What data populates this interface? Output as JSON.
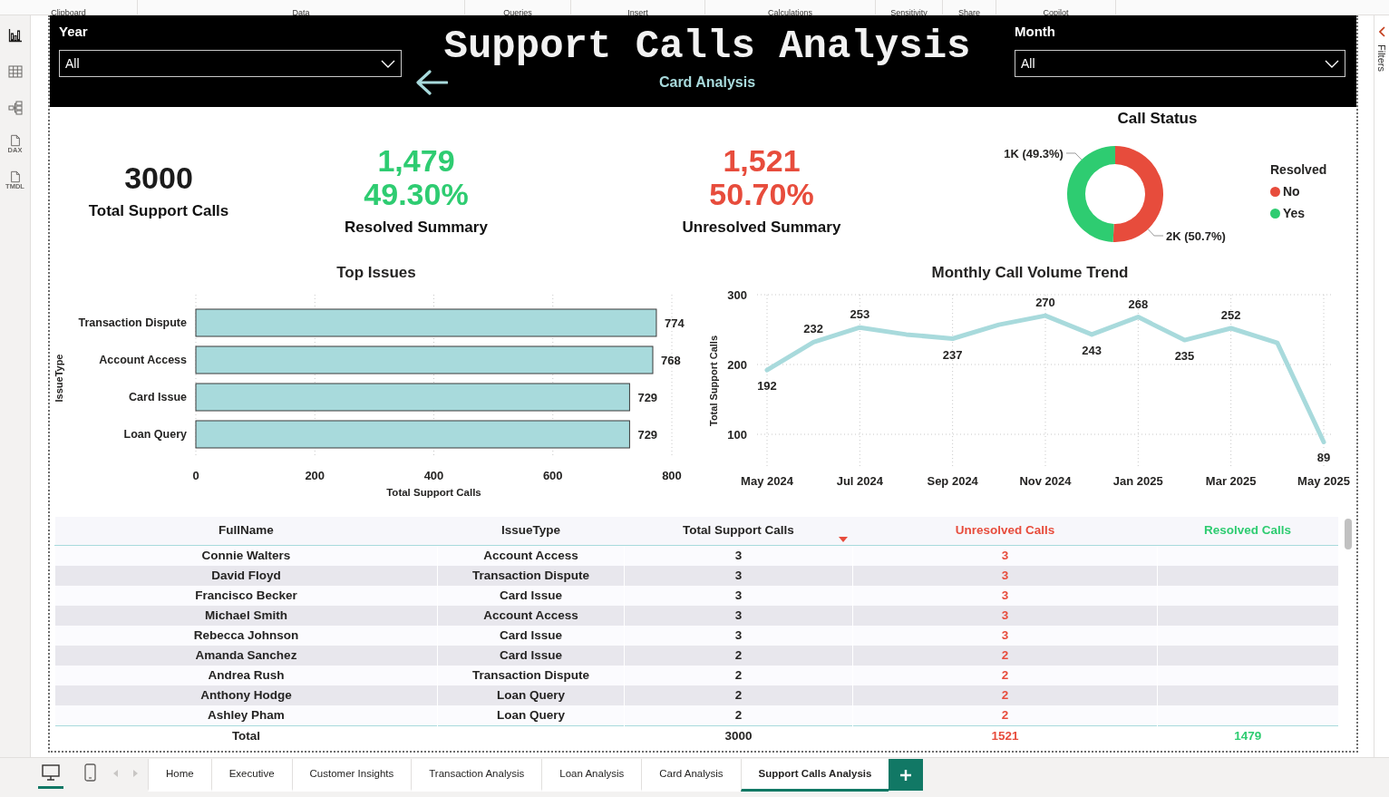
{
  "ribbon": {
    "groups": [
      "Clipboard",
      "Data",
      "Queries",
      "Insert",
      "Calculations",
      "Sensitivity",
      "Share",
      "Copilot"
    ]
  },
  "view_rail": [
    {
      "kind": "report",
      "selected": true
    },
    {
      "kind": "table",
      "selected": false
    },
    {
      "kind": "model",
      "selected": false
    },
    {
      "kind": "dax",
      "label": "DAX",
      "selected": false
    },
    {
      "kind": "tmdl",
      "label": "TMDL",
      "selected": false
    }
  ],
  "header": {
    "slicers": [
      {
        "label": "Year",
        "value": "All"
      },
      {
        "label": "Month",
        "value": "All"
      }
    ],
    "title": "Support Calls Analysis",
    "subtitle": "Card Analysis"
  },
  "kpis": [
    {
      "value": "3000",
      "label": "Total Support Calls",
      "color": "#1b1b1b"
    },
    {
      "value": "1,479",
      "percent": "49.30%",
      "label": "Resolved Summary",
      "color": "#2ecc71"
    },
    {
      "value": "1,521",
      "percent": "50.70%",
      "label": "Unresolved Summary",
      "color": "#e74c3c"
    }
  ],
  "call_status": {
    "chart_data": {
      "type": "donut",
      "title": "Call Status",
      "categories": [
        "No",
        "Yes"
      ],
      "values": [
        50.7,
        49.3
      ],
      "colors": [
        "#e74c3c",
        "#2ecc71"
      ],
      "value_labels": [
        "2K (50.7%)",
        "1K (49.3%)"
      ],
      "legend_title": "Resolved",
      "legend": "right"
    }
  },
  "top_issues": {
    "chart_data": {
      "type": "bar",
      "orientation": "horizontal",
      "title": "Top Issues",
      "xlabel": "Total Support Calls",
      "ylabel": "IssueType",
      "categories": [
        "Transaction Dispute",
        "Account Access",
        "Card Issue",
        "Loan Query"
      ],
      "values": [
        774,
        768,
        729,
        729
      ],
      "color": "#a8dadc",
      "xlim": [
        0,
        800
      ],
      "xticks": [
        0,
        200,
        400,
        600,
        800
      ],
      "data_labels": true,
      "grid": true
    }
  },
  "monthly_trend": {
    "chart_data": {
      "type": "line",
      "title": "Monthly Call Volume Trend",
      "ylabel": "Total Support Calls",
      "categories": [
        "May 2024",
        null,
        "Jul 2024",
        null,
        "Sep 2024",
        null,
        "Nov 2024",
        null,
        "Jan 2025",
        null,
        "Mar 2025",
        null,
        "May 2025"
      ],
      "values": [
        192,
        232,
        253,
        243,
        237,
        257,
        270,
        243,
        268,
        235,
        252,
        231,
        89
      ],
      "color": "#a8dadc",
      "ylim": [
        50,
        300
      ],
      "yticks": [
        100,
        200,
        300
      ],
      "value_labels": [
        "192",
        "232",
        "253",
        null,
        "237",
        null,
        "270",
        "243",
        "268",
        "235",
        "252",
        null,
        "89"
      ],
      "grid": true
    }
  },
  "table": {
    "columns": [
      {
        "label": "FullName",
        "sorted_descending": false
      },
      {
        "label": "IssueType",
        "sorted_descending": false
      },
      {
        "label": "Total Support Calls",
        "sorted_descending": true
      },
      {
        "label": "Unresolved Calls",
        "color": "#e74c3c",
        "sorted_descending": false
      },
      {
        "label": "Resolved Calls",
        "color": "#2ecc71",
        "sorted_descending": false
      }
    ],
    "rows": [
      [
        "Connie Walters",
        "Account Access",
        "3",
        "3"
      ],
      [
        "David Floyd",
        "Transaction Dispute",
        "3",
        "3"
      ],
      [
        "Francisco Becker",
        "Card Issue",
        "3",
        "3"
      ],
      [
        "Michael Smith",
        "Account Access",
        "3",
        "3"
      ],
      [
        "Rebecca Johnson",
        "Card Issue",
        "3",
        "3"
      ],
      [
        "Amanda Sanchez",
        "Card Issue",
        "2",
        "2"
      ],
      [
        "Andrea Rush",
        "Transaction Dispute",
        "2",
        "2"
      ],
      [
        "Anthony Hodge",
        "Loan Query",
        "2",
        "2"
      ],
      [
        "Ashley Pham",
        "Loan Query",
        "2",
        "2"
      ]
    ],
    "total": {
      "label": "Total",
      "values": [
        "3000",
        "1521",
        "1479"
      ]
    }
  },
  "filters_pane": {
    "label": "Filters"
  },
  "page_tabs": {
    "views": [
      {
        "kind": "desktop",
        "selected": true
      },
      {
        "kind": "phone",
        "selected": false
      }
    ],
    "tabs": [
      {
        "label": "Home",
        "selected": false
      },
      {
        "label": "Executive",
        "selected": false
      },
      {
        "label": "Customer Insights",
        "selected": false
      },
      {
        "label": "Transaction Analysis",
        "selected": false
      },
      {
        "label": "Loan Analysis",
        "selected": false
      },
      {
        "label": "Card Analysis",
        "selected": false
      },
      {
        "label": "Support Calls Analysis",
        "selected": true
      }
    ]
  }
}
